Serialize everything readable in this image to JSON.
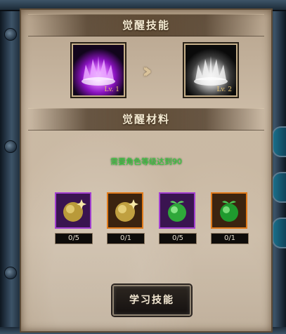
{
  "sections": {
    "skill_title": "觉醒技能",
    "material_title": "觉醒材料"
  },
  "skills": {
    "current": {
      "level_label": "Lv. 1",
      "icon": "purple-flame-crown-icon",
      "color": "#b51fe0"
    },
    "next": {
      "level_label": "Lv. 2",
      "icon": "white-flame-crown-icon",
      "color": "#e8e8e8"
    },
    "arrow_icon": "double-chevron-right-icon"
  },
  "requirement": "需要角色等级达到90",
  "materials": [
    {
      "icon": "gold-orb-icon",
      "frame_color": "#a23fd0",
      "count": "0/5"
    },
    {
      "icon": "gold-orb-icon",
      "frame_color": "#e07a1a",
      "count": "0/1"
    },
    {
      "icon": "green-orb-icon",
      "frame_color": "#a23fd0",
      "count": "0/5"
    },
    {
      "icon": "green-orb-icon",
      "frame_color": "#e07a1a",
      "count": "0/1"
    }
  ],
  "learn_button": "学习技能"
}
